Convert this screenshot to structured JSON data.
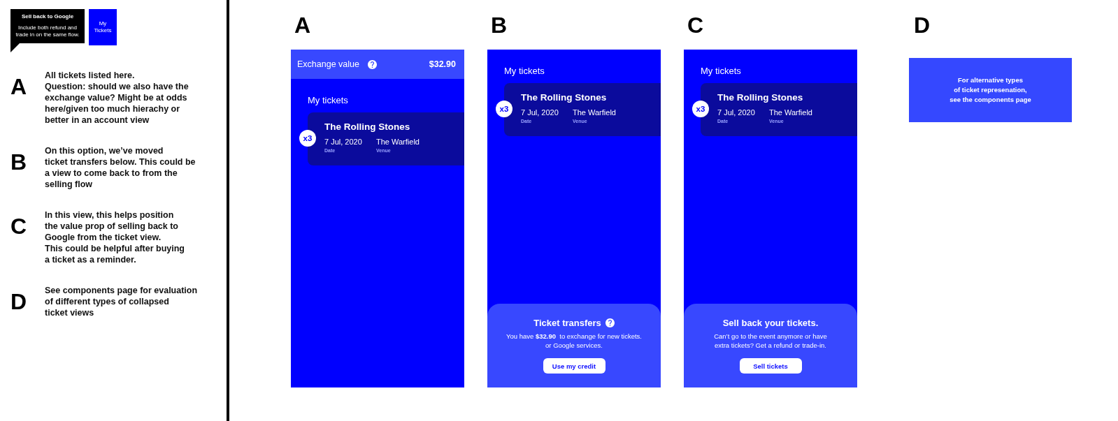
{
  "legend": {
    "callout": {
      "title": "Sell back to Google",
      "text": "Include both refund and\ntrade in on the same flow."
    },
    "tile": {
      "label": "My\nTickets"
    }
  },
  "notes": [
    {
      "letter": "A",
      "text": "All tickets listed here.\nQuestion: should we also have the\nexchange value? Might be at odds\nhere/given too much hierachy or\nbetter in an account view"
    },
    {
      "letter": "B",
      "text": "On this option, we’ve moved\nticket transfers below. This could be\na view to come back to from the\nselling flow"
    },
    {
      "letter": "C",
      "text": "In this view, this helps position\nthe value prop of selling back to\nGoogle from the ticket view.\nThis could be helpful after buying\na ticket as a reminder."
    },
    {
      "letter": "D",
      "text": "See components page for evaluation\nof different types of collapsed\nticket views"
    }
  ],
  "frames": [
    {
      "label": "A",
      "kind": "screen",
      "header": {
        "label": "Exchange value",
        "help_icon": true,
        "amount": "$32.90"
      },
      "section_title": "My tickets",
      "ticket": {
        "count": "x3",
        "title": "The Rolling Stones",
        "fields": [
          {
            "value": "7 Jul, 2020",
            "label": "Date"
          },
          {
            "value": "The Warfield",
            "label": "Venue"
          }
        ]
      }
    },
    {
      "label": "B",
      "kind": "screen",
      "section_title": "My tickets",
      "ticket": {
        "count": "x3",
        "title": "The Rolling Stones",
        "fields": [
          {
            "value": "7 Jul, 2020",
            "label": "Date"
          },
          {
            "value": "The Warfield",
            "label": "Venue"
          }
        ]
      },
      "panel": {
        "title": "Ticket transfers",
        "help_icon": true,
        "text": "You have **$32.90**  to exchange for new tickets.\nor Google services.",
        "button": "Use my credit"
      }
    },
    {
      "label": "C",
      "kind": "screen",
      "section_title": "My tickets",
      "ticket": {
        "count": "x3",
        "title": "The Rolling Stones",
        "fields": [
          {
            "value": "7 Jul, 2020",
            "label": "Date"
          },
          {
            "value": "The Warfield",
            "label": "Venue"
          }
        ]
      },
      "panel": {
        "title": "Sell back your tickets.",
        "text": "Can’t go to the event anymore or have\nextra tickets? Get a refund or trade-in.",
        "button": "Sell tickets"
      }
    },
    {
      "label": "D",
      "kind": "note",
      "text": "For alternative types\nof ticket represenation,\nsee the components page"
    }
  ]
}
